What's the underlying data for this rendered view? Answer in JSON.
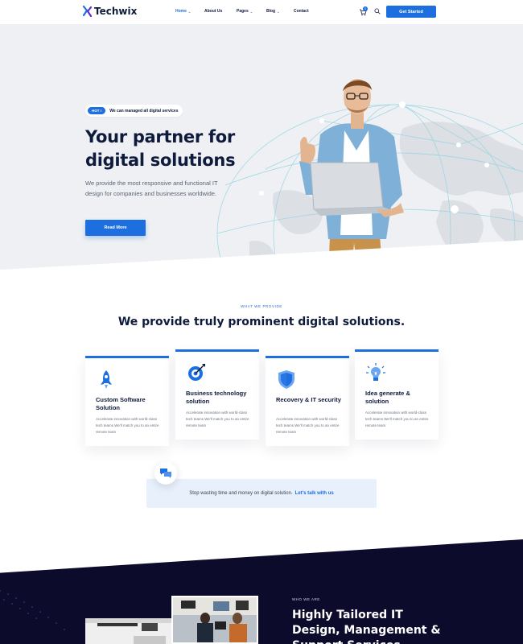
{
  "brand": {
    "name": "Techwix",
    "accent": "#1d6fe0",
    "dark": "#0f1b3d"
  },
  "nav": {
    "items": [
      {
        "label": "Home",
        "has_caret": true,
        "active": true
      },
      {
        "label": "About Us",
        "has_caret": false,
        "active": false
      },
      {
        "label": "Pages",
        "has_caret": true,
        "active": false
      },
      {
        "label": "Blog",
        "has_caret": true,
        "active": false
      },
      {
        "label": "Contact",
        "has_caret": false,
        "active": false
      }
    ],
    "cart_count": "0",
    "cta": "Get Started"
  },
  "hero": {
    "badge_tag": "HOT !",
    "badge_text": "We can managed all digital services",
    "title_line1": "Your partner for",
    "title_line2": "digital solutions",
    "description": "We provide the most responsive and functional IT design for companies and businesses worldwide.",
    "button": "Read More"
  },
  "services": {
    "eyebrow": "WHAT WE PROVIDE",
    "title": "We provide truly prominent digital solutions.",
    "cards": [
      {
        "icon": "rocket-icon",
        "title": "Custom Software Solution",
        "text": "Accelerate innovation with world-class tech teams We'll match you to an entire remote team"
      },
      {
        "icon": "target-icon",
        "title": "Business technology solution",
        "text": "Accelerate innovation with world-class tech teams We'll match you to an entire remote team"
      },
      {
        "icon": "shield-icon",
        "title": "Recovery & IT security",
        "text": "Accelerate innovation with world-class tech teams We'll match you to an entire remote team"
      },
      {
        "icon": "lightbulb-icon",
        "title": "Idea generate & solution",
        "text": "Accelerate innovation with world-class tech teams We'll match you to an entire remote team"
      }
    ]
  },
  "talk": {
    "text": "Stop wasting time and money on digital solution.",
    "link": "Let's talk with us"
  },
  "about": {
    "eyebrow": "WHO WE ARE",
    "title": "Highly Tailored IT Design, Management & Support Services."
  }
}
